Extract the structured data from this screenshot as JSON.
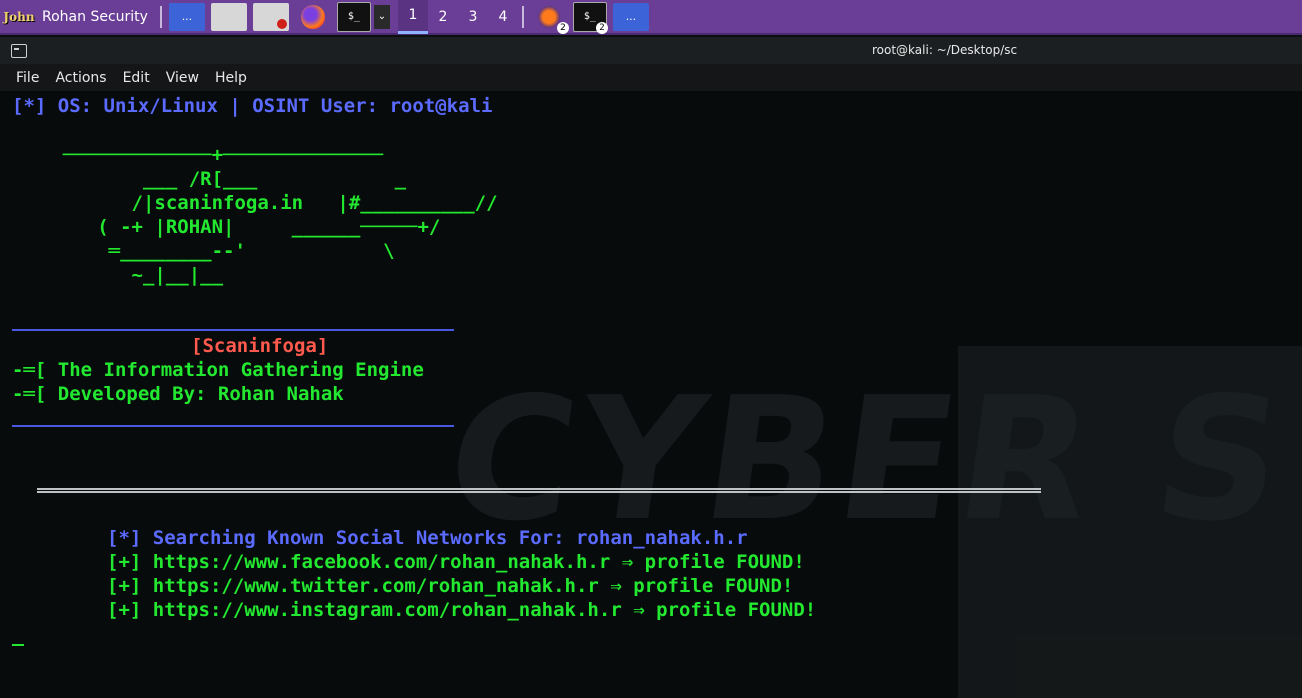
{
  "taskbar": {
    "logo_text": "John",
    "title": "Rohan Security",
    "workspaces": [
      "1",
      "2",
      "3",
      "4"
    ],
    "active_workspace": "1",
    "app_dots": "...",
    "term_glyph": "$_",
    "badge_count": "2",
    "chevron": "⌄"
  },
  "window": {
    "title": "root@kali: ~/Desktop/sc"
  },
  "menu": {
    "items": [
      "File",
      "Actions",
      "Edit",
      "View",
      "Help"
    ]
  },
  "terminal": {
    "header": "[*] OS: Unix/Linux | OSINT User: root@kali",
    "ascii": [
      "  ─────────────+──────────────",
      "         ___ /R[___            _",
      "        /|scaninfoga.in   |#__________//",
      "     ( -+ |ROHAN|     ______─────+/",
      "      ═________--'            \\",
      "        ~_|__|__"
    ],
    "banner_name": "[Scaninfoga]",
    "banner_line1": "-═[ The Information Gathering Engine",
    "banner_line2": "-═[ Developed By: Rohan Nahak",
    "search_line": "[*] Searching Known Social Networks For: rohan_nahak.h.r",
    "results": [
      "[+] https://www.facebook.com/rohan_nahak.h.r ⇒ profile FOUND!",
      "[+] https://www.twitter.com/rohan_nahak.h.r ⇒ profile FOUND!",
      "[+] https://www.instagram.com/rohan_nahak.h.r ⇒ profile FOUND!"
    ]
  },
  "colors": {
    "taskbar": "#6a3e97",
    "terminal_bg": "#070b0c",
    "text_blue": "#5b6bff",
    "text_green": "#23e830",
    "text_red": "#ff5a4d"
  }
}
